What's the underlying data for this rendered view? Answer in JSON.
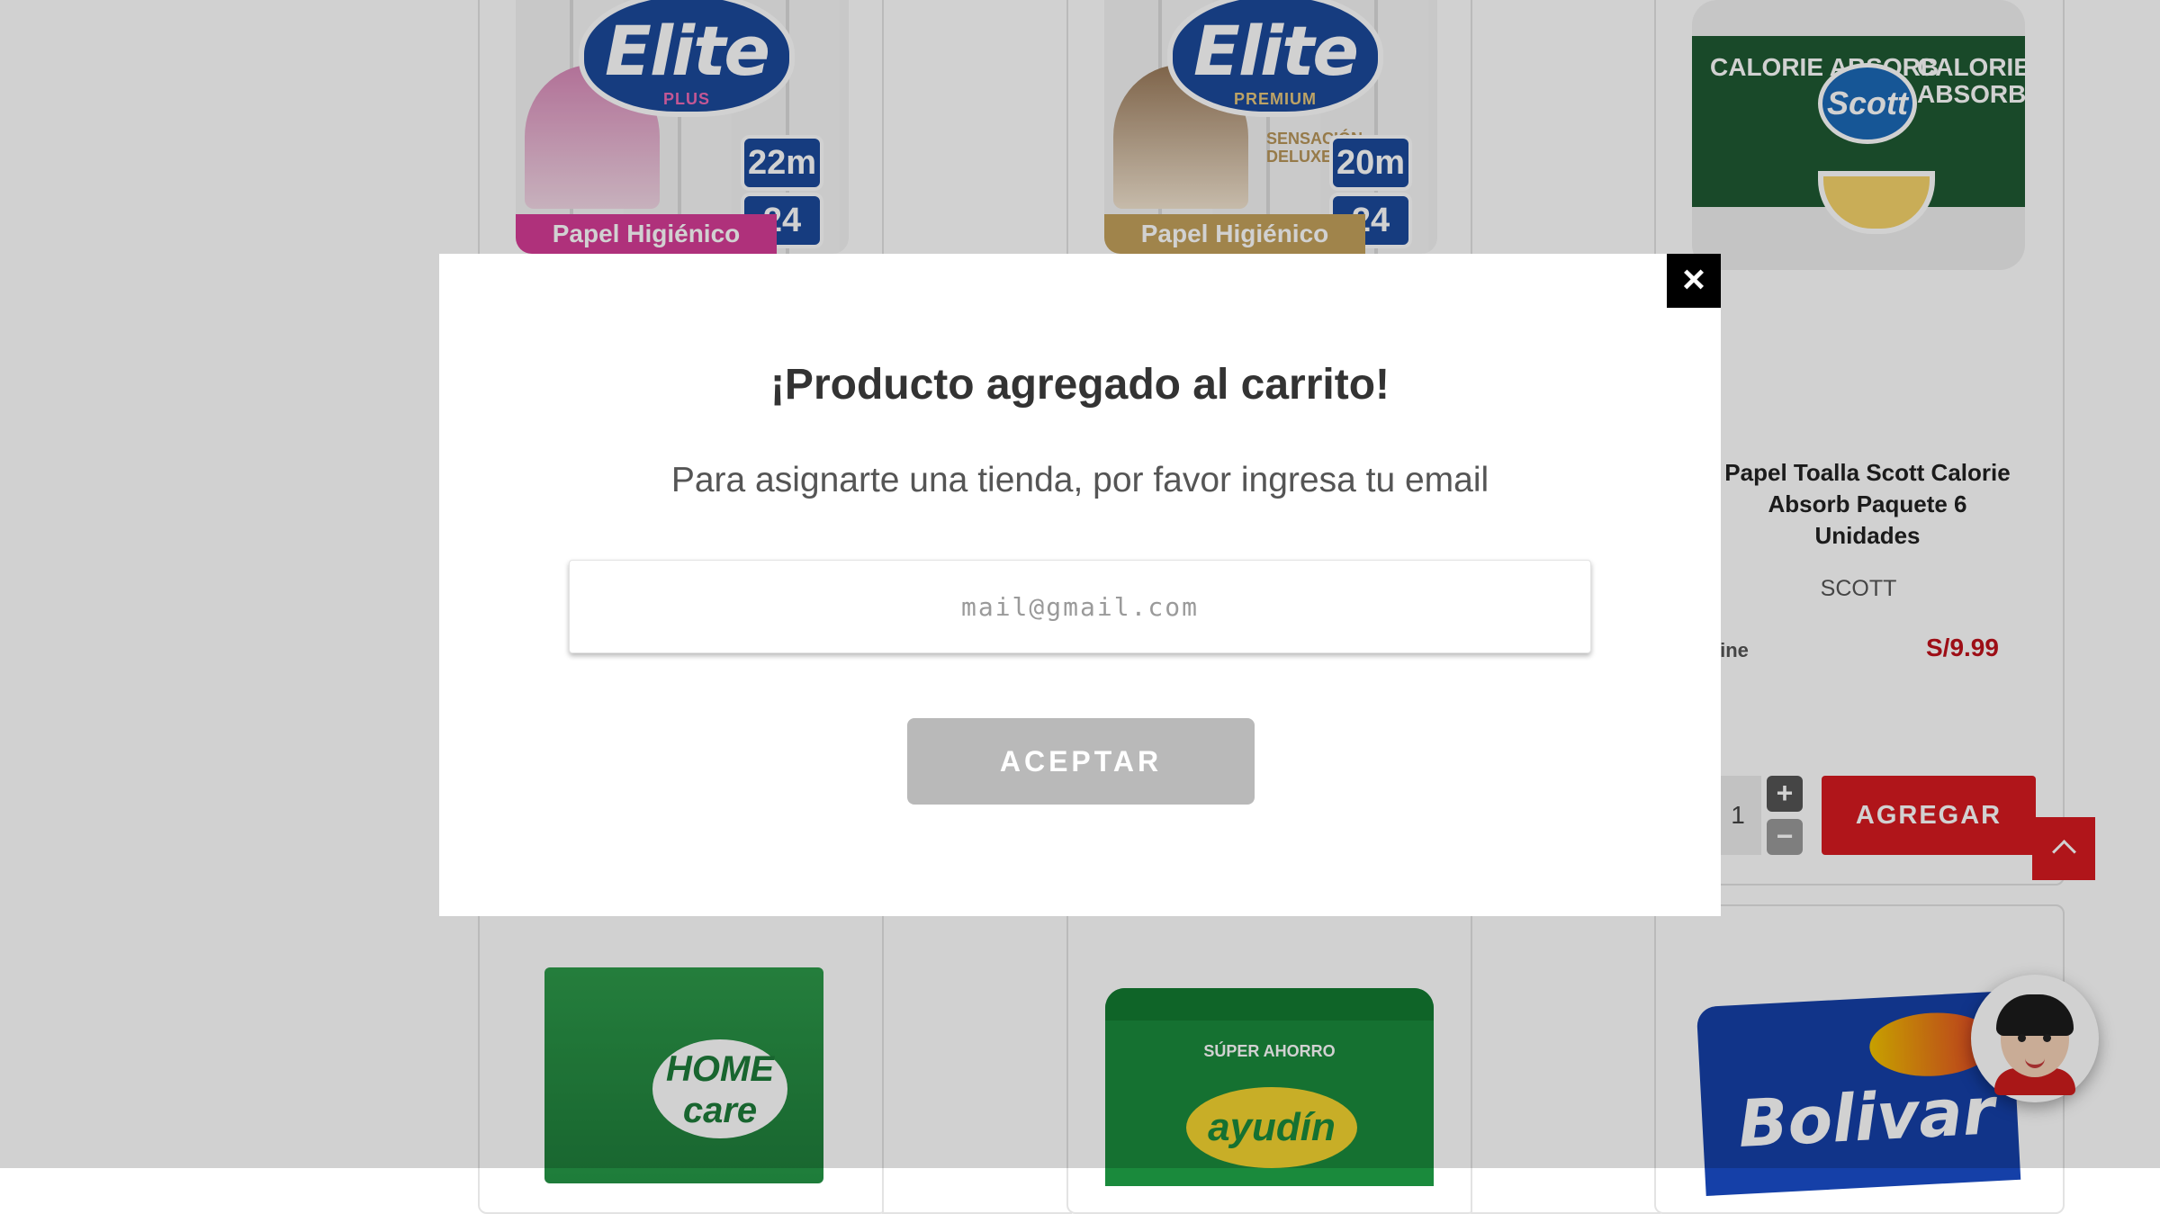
{
  "modal": {
    "title": "¡Producto agregado al carrito!",
    "subtitle": "Para asignarte una tienda, por favor ingresa tu email",
    "email_placeholder": "mail@gmail.com",
    "email_value": "",
    "accept_label": "ACEPTAR",
    "close_icon": "×"
  },
  "products": {
    "elite_plus": {
      "brand_mark": "Elite",
      "variant": "PLUS",
      "length": "22m",
      "count": "24",
      "band": "Papel Higiénico",
      "accent": "#d63c97"
    },
    "elite_premium": {
      "brand_mark": "Elite",
      "variant": "PREMIUM",
      "extra": "SENSACIÓN DELUXE",
      "length": "20m",
      "count": "24",
      "band": "Papel Higiénico",
      "accent": "#c4a25c"
    },
    "scott": {
      "brand_mark": "Scott",
      "pack_text_left": "CALORIE ABSORB",
      "pack_text_right": "CALORIE ABSORB",
      "title": "Papel Toalla Scott Calorie Absorb Paquete 6 Unidades",
      "brand": "SCOTT",
      "availability": "line",
      "price": "S/9.99",
      "quantity": "1",
      "plus": "+",
      "minus": "−",
      "add_label": "AGREGAR"
    },
    "home_care": {
      "brand_mark": "HOME care"
    },
    "ayudin": {
      "band": "SÚPER AHORRO",
      "brand_mark": "ayudín"
    },
    "bolivar": {
      "brand_mark": "Bolivar"
    }
  },
  "colors": {
    "brand_red": "#d71a20",
    "price_red": "#c0121b",
    "disabled_button": "#b9b9b9",
    "overlay": "rgba(0,0,0,0.18)"
  },
  "icons": {
    "close": "close-icon",
    "scroll_top": "chevron-up-icon",
    "chat": "chat-avatar-icon"
  }
}
